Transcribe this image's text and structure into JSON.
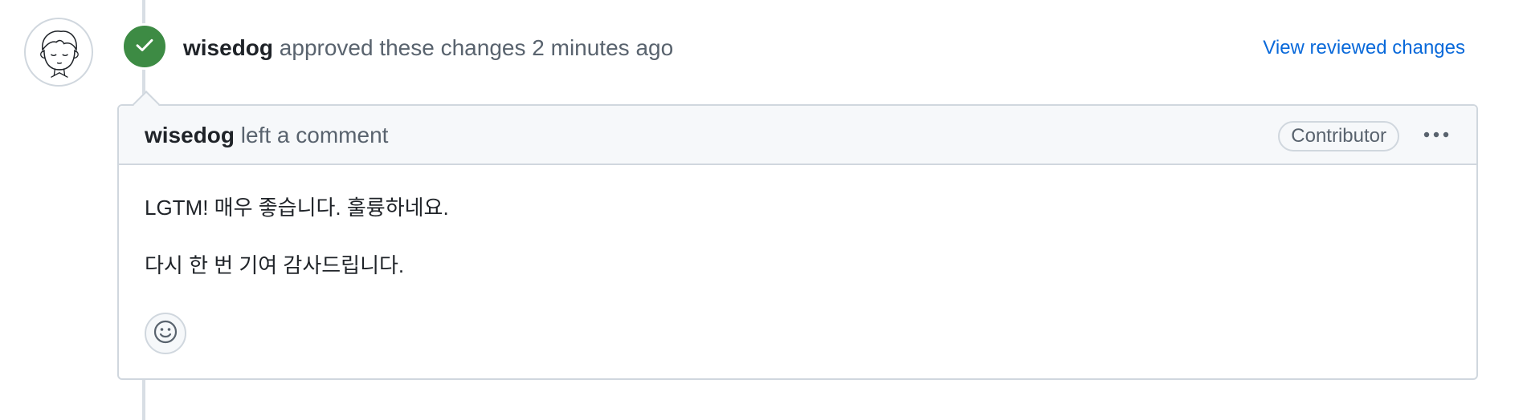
{
  "review": {
    "author": "wisedog",
    "action_text": "approved these changes",
    "time_ago": "2 minutes ago",
    "view_changes_label": "View reviewed changes",
    "status_color": "#3d8b44",
    "status_icon": "check-icon"
  },
  "comment": {
    "author": "wisedog",
    "action_text": "left a comment",
    "role_label": "Contributor",
    "menu_icon": "kebab-horizontal-icon",
    "body": [
      "LGTM! 매우 좋습니다. 훌륭하네요.",
      "다시 한 번 기여 감사드립니다."
    ],
    "reaction_icon": "smiley-icon"
  },
  "colors": {
    "link": "#0969da",
    "border": "#d0d7de",
    "header_bg": "#f6f8fa",
    "muted_text": "#59636e"
  }
}
